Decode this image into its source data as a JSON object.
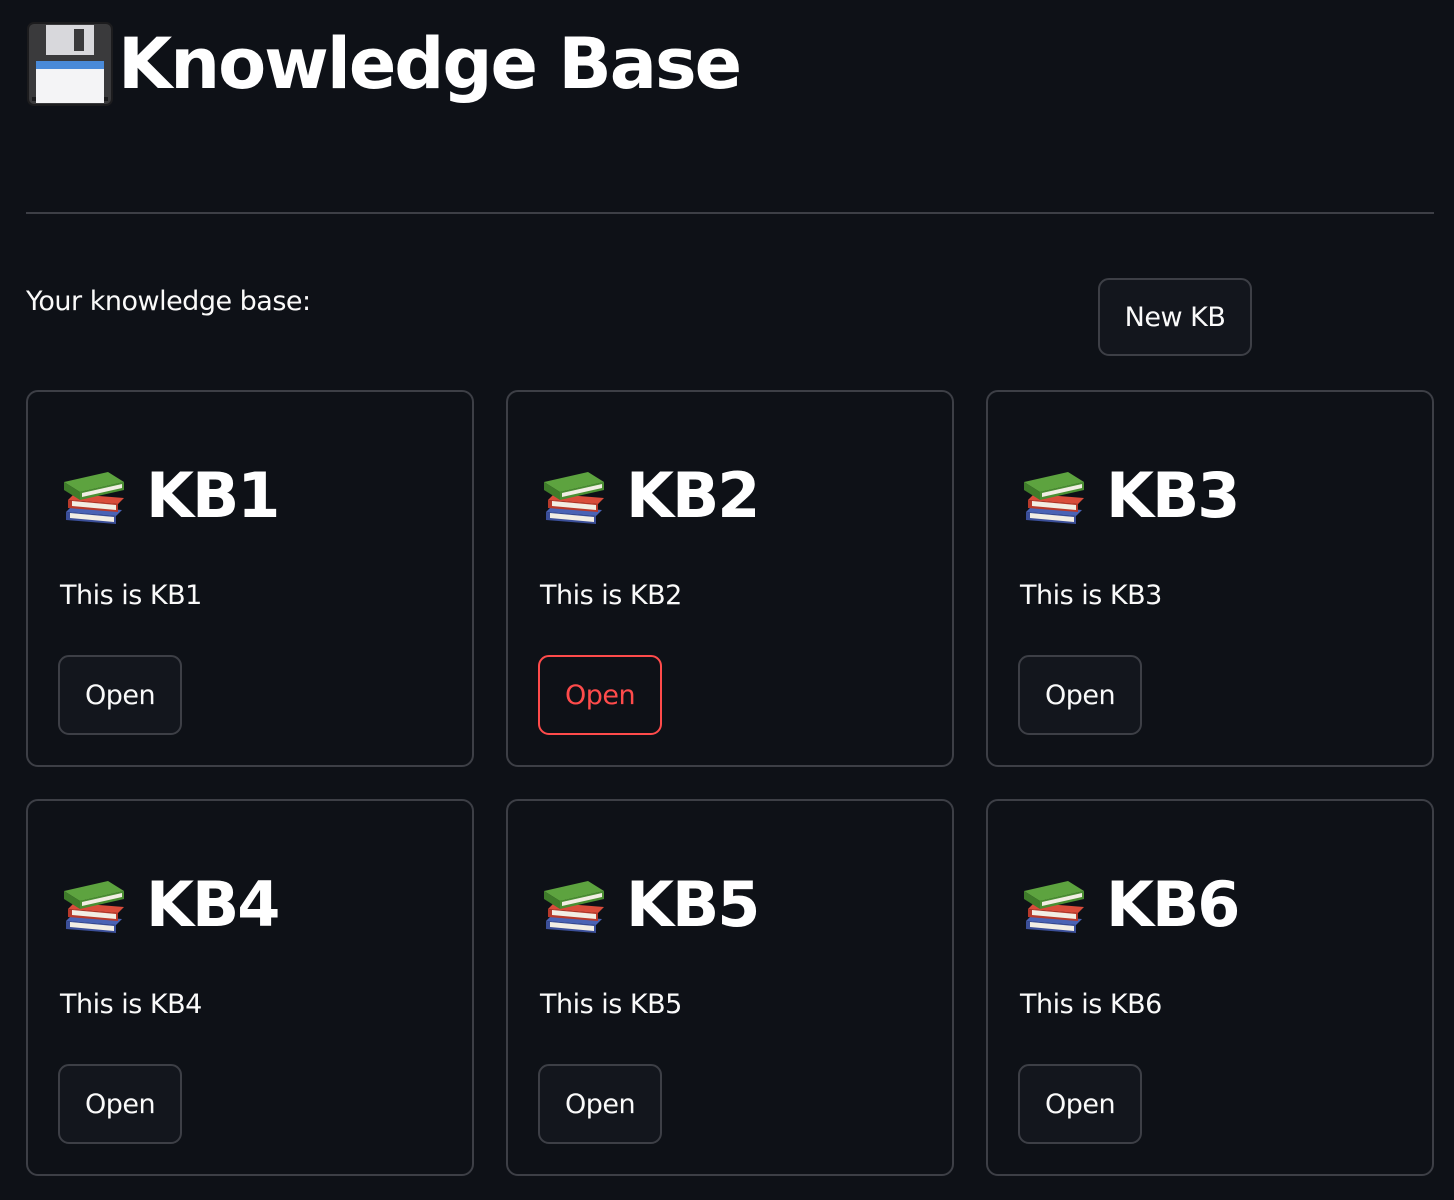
{
  "header": {
    "title": "Knowledge Base",
    "title_icon": "floppy-disk-icon"
  },
  "section": {
    "label": "Your knowledge base:",
    "new_button_label": "New KB"
  },
  "accent_color": "#ff4b4b",
  "knowledge_bases": [
    {
      "name": "KB1",
      "description": "This is KB1",
      "open_label": "Open",
      "icon": "books-icon",
      "focused": false
    },
    {
      "name": "KB2",
      "description": "This is KB2",
      "open_label": "Open",
      "icon": "books-icon",
      "focused": true
    },
    {
      "name": "KB3",
      "description": "This is KB3",
      "open_label": "Open",
      "icon": "books-icon",
      "focused": false
    },
    {
      "name": "KB4",
      "description": "This is KB4",
      "open_label": "Open",
      "icon": "books-icon",
      "focused": false
    },
    {
      "name": "KB5",
      "description": "This is KB5",
      "open_label": "Open",
      "icon": "books-icon",
      "focused": false
    },
    {
      "name": "KB6",
      "description": "This is KB6",
      "open_label": "Open",
      "icon": "books-icon",
      "focused": false
    }
  ]
}
